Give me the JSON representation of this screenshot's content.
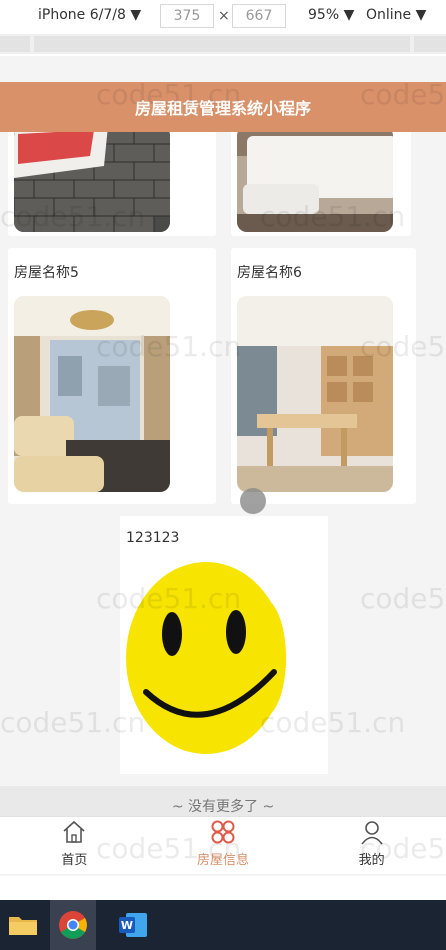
{
  "devtools": {
    "device": "iPhone 6/7/8 ▼",
    "width": "375",
    "height": "667",
    "times": "×",
    "zoom": "95% ▼",
    "network": "Online ▼"
  },
  "nav": {
    "title": "房屋租赁管理系统小程序"
  },
  "cards": [
    {
      "name": ""
    },
    {
      "name": ""
    },
    {
      "name": "房屋名称5"
    },
    {
      "name": "房屋名称6"
    }
  ],
  "last_card": {
    "name": "123123"
  },
  "footer": {
    "no_more": "~ 没有更多了 ~"
  },
  "tabbar": {
    "items": [
      {
        "label": "首页",
        "icon": "home-icon"
      },
      {
        "label": "房屋信息",
        "icon": "grid-icon"
      },
      {
        "label": "我的",
        "icon": "user-icon"
      }
    ]
  },
  "watermark": "code51.cn",
  "colors": {
    "accent": "#d9916a",
    "taskbar": "#1b2432"
  }
}
